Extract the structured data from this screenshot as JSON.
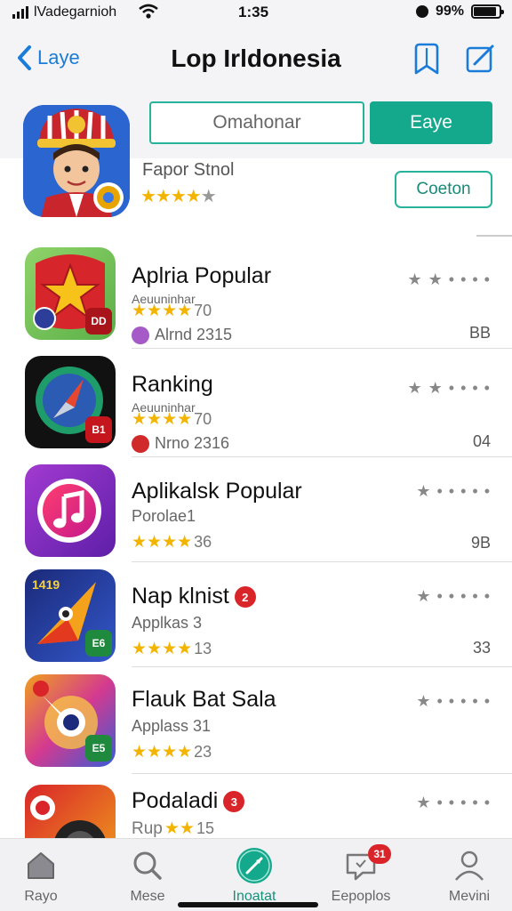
{
  "status": {
    "carrier": "lVadegarnioh",
    "time": "1:35",
    "battery": "99%"
  },
  "nav": {
    "back_label": "Laye",
    "title": "Lop Irldonesia"
  },
  "hero": {
    "segment_left": "Omahonar",
    "segment_right": "Eaye",
    "app_name": "Fapor Stnol",
    "stars": "★★★★",
    "star_half": "★",
    "button_label": "Coeton"
  },
  "rows": [
    {
      "title": "Aplria Popular",
      "sub": "Aeuuninhar",
      "stars": "★★★★",
      "rating": "70",
      "meta": "Alrnd 2315",
      "right": "BB",
      "dots": "★ ★ • • • •",
      "icon_tag": "DD"
    },
    {
      "title": "Ranking",
      "sub": "Aeuuninhar",
      "stars": "★★★★",
      "rating": "70",
      "meta": "Nrno 2316",
      "right": "04",
      "dots": "★ ★ • • • •",
      "icon_tag": "B1"
    },
    {
      "title": "Aplikalsk Popular",
      "sub": "Porolae1",
      "stars": "★★★★",
      "rating": "36",
      "meta": "",
      "right": "9B",
      "dots": "★ • • • • •",
      "icon_tag": ""
    },
    {
      "title": "Nap klnist",
      "badge": "2",
      "sub": "Applkas 3",
      "stars": "★★★★",
      "rating": "13",
      "meta": "",
      "right": "33",
      "dots": "★ • • • • •",
      "icon_tag": "E6",
      "icon_text": "1419"
    },
    {
      "title": "Flauk Bat Sala",
      "sub": "Applass 31",
      "stars": "★★★★",
      "rating": "23",
      "meta": "",
      "right": "",
      "dots": "★ • • • • •",
      "icon_tag": "E5"
    },
    {
      "title": "Podaladi",
      "badge": "3",
      "sub": "Rup",
      "stars": "★★",
      "rating": "15",
      "meta": "",
      "right": "",
      "dots": "★ • • • • •",
      "icon_tag": ""
    }
  ],
  "tabs": [
    {
      "label": "Rayo",
      "icon": "home-icon"
    },
    {
      "label": "Mese",
      "icon": "search-icon"
    },
    {
      "label": "Inoatat",
      "icon": "compass-icon"
    },
    {
      "label": "Eepoplos",
      "icon": "chat-icon",
      "badge": "31"
    },
    {
      "label": "Mevini",
      "icon": "person-icon"
    }
  ],
  "colors": {
    "accent": "#14a88c",
    "link": "#1a7cd8",
    "star": "#f3b400",
    "badge": "#d9252a"
  }
}
